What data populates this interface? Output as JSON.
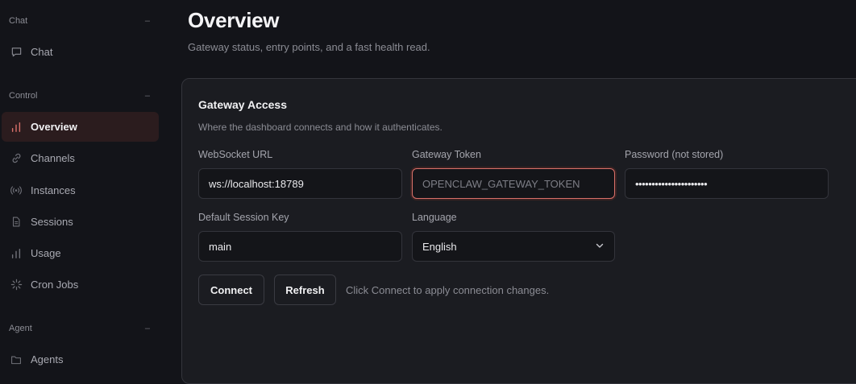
{
  "sidebar": {
    "sections": [
      {
        "title": "Chat",
        "collapse": "–"
      },
      {
        "title": "Control",
        "collapse": "–"
      },
      {
        "title": "Agent",
        "collapse": "–"
      }
    ],
    "items": [
      {
        "label": "Chat",
        "icon": "chat-bubble-icon"
      },
      {
        "label": "Overview",
        "icon": "bar-chart-icon",
        "active": true
      },
      {
        "label": "Channels",
        "icon": "link-icon"
      },
      {
        "label": "Instances",
        "icon": "broadcast-icon"
      },
      {
        "label": "Sessions",
        "icon": "document-icon"
      },
      {
        "label": "Usage",
        "icon": "bar-chart-icon"
      },
      {
        "label": "Cron Jobs",
        "icon": "loader-icon"
      },
      {
        "label": "Agents",
        "icon": "folder-icon"
      }
    ]
  },
  "page": {
    "title": "Overview",
    "subtitle": "Gateway status, entry points, and a fast health read."
  },
  "card": {
    "title": "Gateway Access",
    "subtitle": "Where the dashboard connects and how it authenticates.",
    "fields": {
      "ws_url": {
        "label": "WebSocket URL",
        "value": "ws://localhost:18789"
      },
      "token": {
        "label": "Gateway Token",
        "placeholder": "OPENCLAW_GATEWAY_TOKEN"
      },
      "password": {
        "label": "Password (not stored)",
        "value": "••••••••••••••••••••••"
      },
      "session_key": {
        "label": "Default Session Key",
        "value": "main"
      },
      "language": {
        "label": "Language",
        "value": "English"
      }
    },
    "connect_label": "Connect",
    "refresh_label": "Refresh",
    "hint": "Click Connect to apply connection changes."
  },
  "colors": {
    "accent": "#d9706a",
    "active_bg": "#2b1c1e",
    "background": "#131419",
    "card": "#1b1c21"
  }
}
